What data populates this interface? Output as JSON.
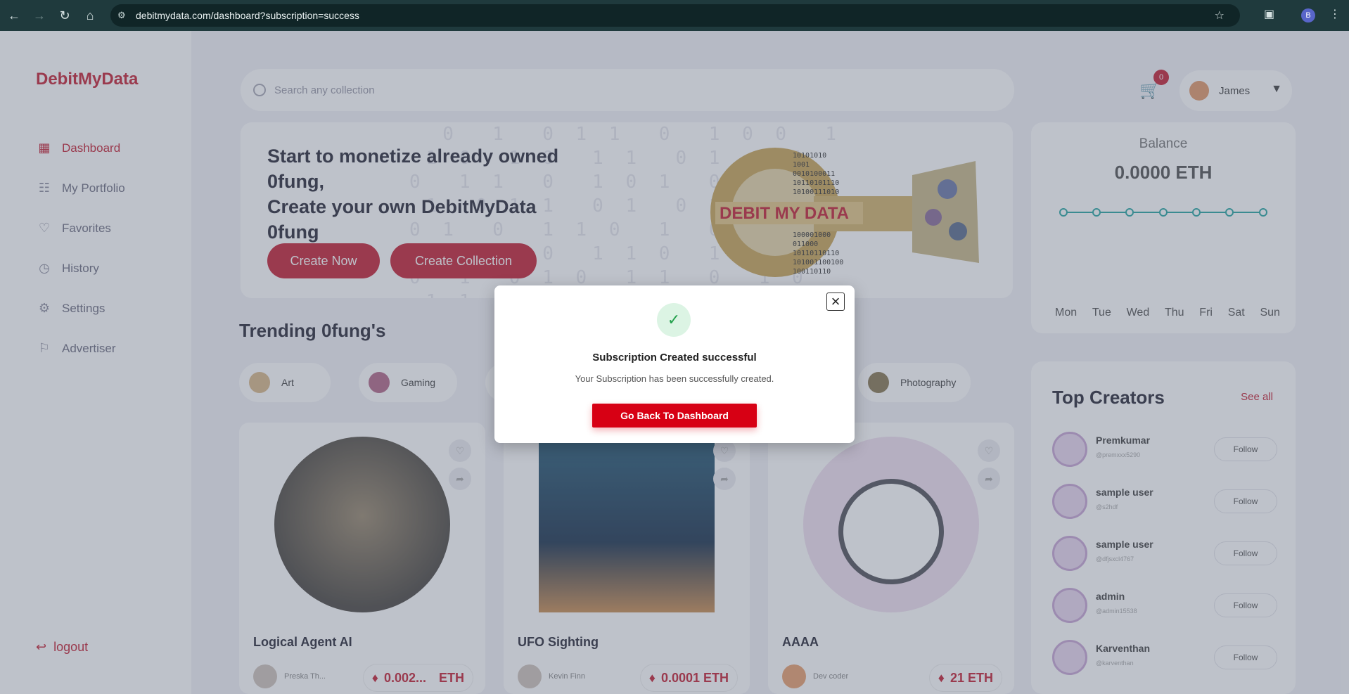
{
  "browser": {
    "url": "debitmydata.com/dashboard?subscription=success",
    "profile_initial": "B",
    "icons": [
      "back-icon",
      "forward-icon",
      "reload-icon",
      "home-icon",
      "site-info-icon",
      "bookmark-star-icon",
      "extensions-icon",
      "menu-icon"
    ]
  },
  "sidebar": {
    "logo": "DebitMyData",
    "items": [
      {
        "label": "Dashboard",
        "icon": "grid-icon",
        "active": true
      },
      {
        "label": "My Portfolio",
        "icon": "portfolio-icon",
        "active": false
      },
      {
        "label": "Favorites",
        "icon": "heart-icon",
        "active": false
      },
      {
        "label": "History",
        "icon": "history-icon",
        "active": false
      },
      {
        "label": "Settings",
        "icon": "gear-icon",
        "active": false
      },
      {
        "label": "Advertiser",
        "icon": "megaphone-icon",
        "active": false
      }
    ],
    "logout": "logout"
  },
  "header": {
    "search_placeholder": "Search any collection",
    "cart_count": "0",
    "user_name": "James"
  },
  "banner": {
    "line1": "Start to monetize already owned 0fung,",
    "line2": "Create your own DebitMyData 0fung",
    "create_now": "Create Now",
    "create_collection": "Create Collection",
    "art_text": "DEBIT MY DATA"
  },
  "balance": {
    "label": "Balance",
    "amount": "0.0000 ETH",
    "days": [
      "Mon",
      "Tue",
      "Wed",
      "Thu",
      "Fri",
      "Sat",
      "Sun"
    ]
  },
  "trending": {
    "title": "Trending 0fung's",
    "categories": [
      "Art",
      "Gaming",
      "",
      "Photography"
    ]
  },
  "cards": [
    {
      "title": "Logical Agent AI",
      "owner": "Preska Th...",
      "price": "0.002...",
      "unit": "ETH"
    },
    {
      "title": "UFO Sighting",
      "owner": "Kevin Finn",
      "price": "0.0001 ETH",
      "unit": ""
    },
    {
      "title": "AAAA",
      "owner": "Dev coder",
      "price": "21 ETH",
      "unit": ""
    }
  ],
  "creators": {
    "title": "Top Creators",
    "see_all": "See all",
    "follow": "Follow",
    "list": [
      {
        "name": "Premkumar",
        "handle": "@premxxx5290"
      },
      {
        "name": "sample user",
        "handle": "@s2hdf"
      },
      {
        "name": "sample user",
        "handle": "@dfjsxcl4767"
      },
      {
        "name": "admin",
        "handle": "@admin15538"
      },
      {
        "name": "Karventhan",
        "handle": "@karventhan"
      }
    ]
  },
  "modal": {
    "title": "Subscription Created successful",
    "message": "Your Subscription has been successfully created.",
    "button": "Go Back To Dashboard"
  },
  "colors": {
    "accent": "#c52537",
    "success": "#22a04b",
    "modal_button": "#d70014"
  }
}
